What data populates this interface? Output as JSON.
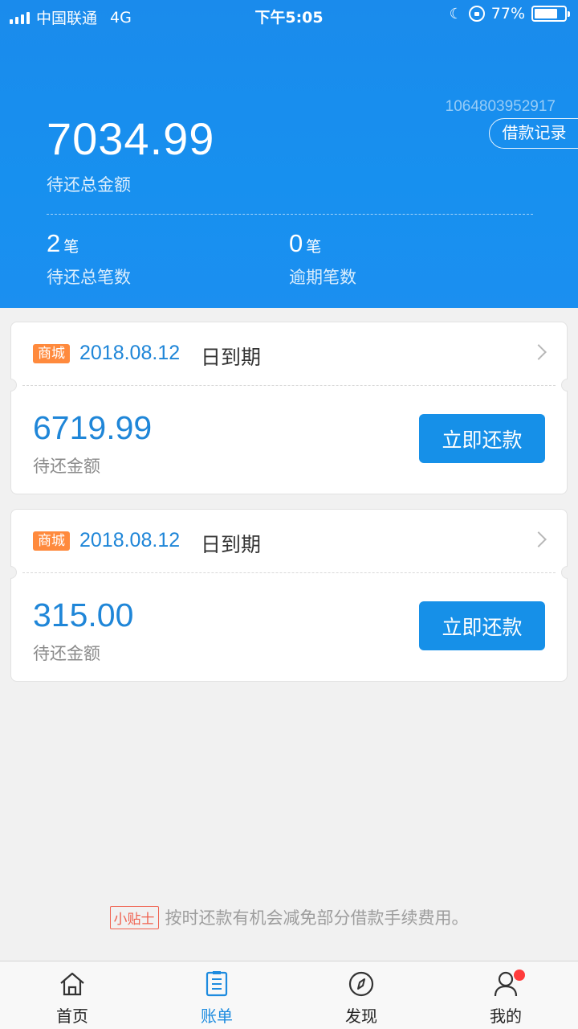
{
  "status_bar": {
    "carrier": "中国联通",
    "network": "4G",
    "time": "下午5:05",
    "battery": "77%",
    "battery_level": 0.77
  },
  "header": {
    "account_id": "1064803952917",
    "history_button": "借款记录",
    "total_amount": "7034.99",
    "total_label": "待还总金额",
    "pending_count": "2",
    "pending_unit": "笔",
    "pending_label": "待还总笔数",
    "overdue_count": "0",
    "overdue_unit": "笔",
    "overdue_label": "逾期笔数"
  },
  "bills": [
    {
      "tag": "商城",
      "due_date": "2018.08.12",
      "due_suffix": "日到期",
      "amount": "6719.99",
      "amount_label": "待还金额",
      "pay_button": "立即还款"
    },
    {
      "tag": "商城",
      "due_date": "2018.08.12",
      "due_suffix": "日到期",
      "amount": "315.00",
      "amount_label": "待还金额",
      "pay_button": "立即还款"
    }
  ],
  "tip": {
    "badge": "小贴士",
    "text": "按时还款有机会减免部分借款手续费用。"
  },
  "tabs": [
    {
      "label": "首页",
      "icon": "home-icon",
      "active": false
    },
    {
      "label": "账单",
      "icon": "bill-icon",
      "active": true
    },
    {
      "label": "发现",
      "icon": "compass-icon",
      "active": false
    },
    {
      "label": "我的",
      "icon": "user-icon",
      "active": false,
      "badge": true
    }
  ],
  "colors": {
    "primary": "#1690e8",
    "accent_text": "#1f86d8",
    "tag": "#ff8a3d",
    "tip": "#f0614f",
    "badge": "#ff3b3b"
  }
}
